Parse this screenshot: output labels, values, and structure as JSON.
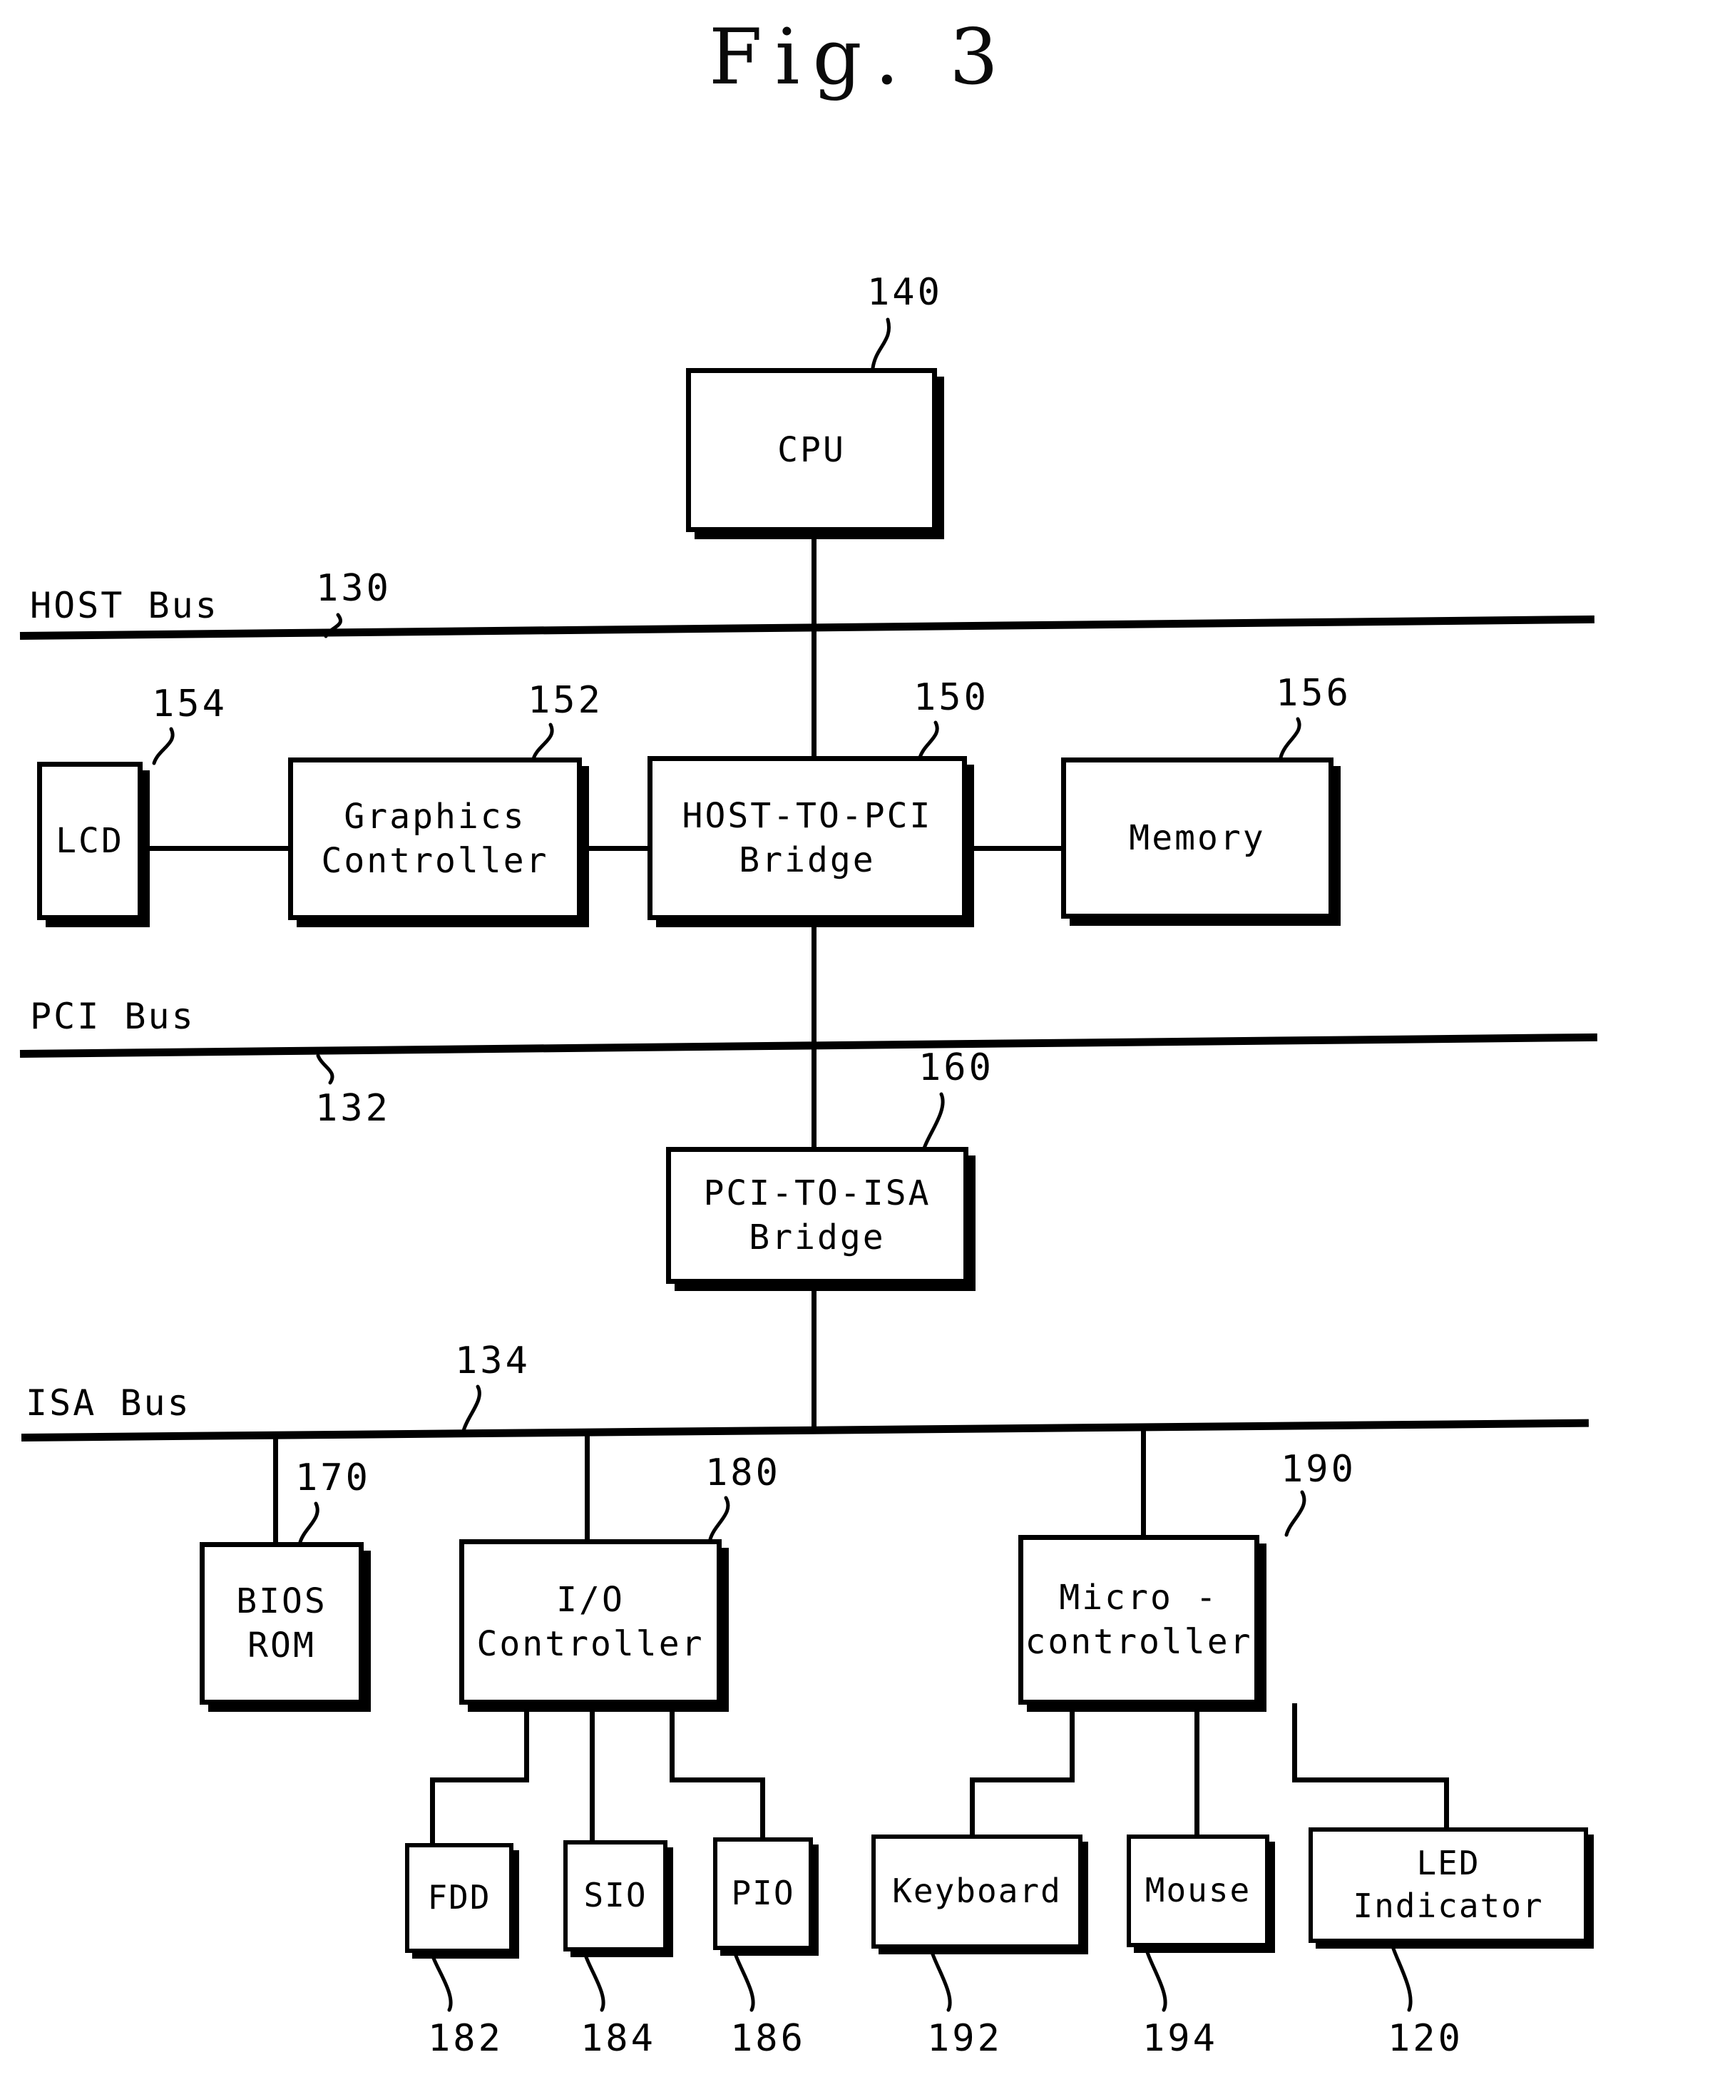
{
  "figure": {
    "title": "Fig. 3"
  },
  "buses": [
    {
      "name": "HOST Bus",
      "label": "HOST Bus",
      "ref": "130"
    },
    {
      "name": "PCI Bus",
      "label": "PCI Bus",
      "ref": "132"
    },
    {
      "name": "ISA Bus",
      "label": "ISA Bus",
      "ref": "134"
    }
  ],
  "blocks": {
    "cpu": {
      "label": "CPU",
      "ref": "140"
    },
    "lcd": {
      "label": "LCD",
      "ref": "154"
    },
    "graphics": {
      "label": "Graphics\nController",
      "ref": "152"
    },
    "host_to_pci": {
      "label": "HOST-TO-PCI\nBridge",
      "ref": "150"
    },
    "memory": {
      "label": "Memory",
      "ref": "156"
    },
    "pci_to_isa": {
      "label": "PCI-TO-ISA\nBridge",
      "ref": "160"
    },
    "bios_rom": {
      "label": "BIOS\nROM",
      "ref": "170"
    },
    "io_controller": {
      "label": "I/O\nController",
      "ref": "180"
    },
    "microctrl": {
      "label": "Micro -\ncontroller",
      "ref": "190"
    },
    "fdd": {
      "label": "FDD",
      "ref": "182"
    },
    "sio": {
      "label": "SIO",
      "ref": "184"
    },
    "pio": {
      "label": "PIO",
      "ref": "186"
    },
    "keyboard": {
      "label": "Keyboard",
      "ref": "192"
    },
    "mouse": {
      "label": "Mouse",
      "ref": "194"
    },
    "led_indicator": {
      "label": "LED Indicator",
      "ref": "120"
    }
  },
  "colors": {
    "ink": "#000000",
    "paper": "#ffffff"
  }
}
